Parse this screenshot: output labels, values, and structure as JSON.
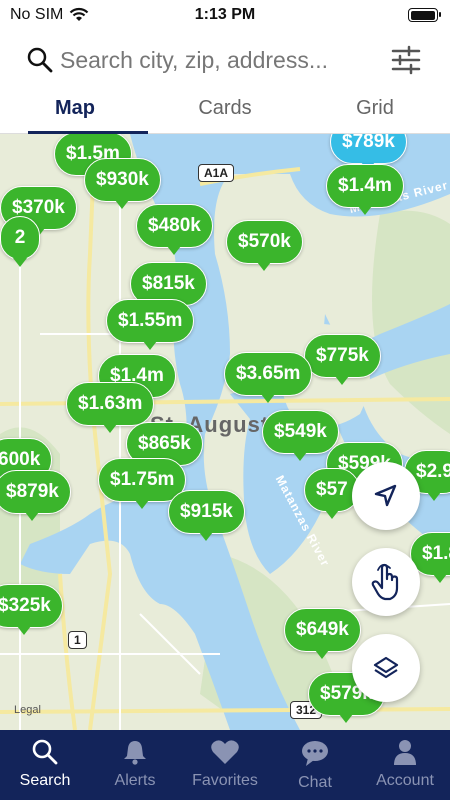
{
  "status_bar": {
    "carrier": "No SIM",
    "time": "1:13 PM"
  },
  "search": {
    "placeholder": "Search city, zip, address..."
  },
  "tabs": [
    {
      "label": "Map",
      "active": true
    },
    {
      "label": "Cards",
      "active": false
    },
    {
      "label": "Grid",
      "active": false
    }
  ],
  "map": {
    "water_labels": [
      "Matanzas River",
      "Matanzas River"
    ],
    "place_label": "St. Augustine",
    "road_shields": [
      "A1A",
      "1",
      "312"
    ],
    "legal": "Legal"
  },
  "price_pins": [
    {
      "label": "$1.5m",
      "color": "green"
    },
    {
      "label": "$930k",
      "color": "green"
    },
    {
      "label": "$370k",
      "color": "green"
    },
    {
      "label": "2",
      "color": "green"
    },
    {
      "label": "$480k",
      "color": "green"
    },
    {
      "label": "$570k",
      "color": "green"
    },
    {
      "label": "$789k",
      "color": "blue"
    },
    {
      "label": "$1.4m",
      "color": "green"
    },
    {
      "label": "$815k",
      "color": "green"
    },
    {
      "label": "$1.55m",
      "color": "green"
    },
    {
      "label": "$775k",
      "color": "green"
    },
    {
      "label": "$1.4m",
      "color": "green"
    },
    {
      "label": "$3.65m",
      "color": "green"
    },
    {
      "label": "$1.63m",
      "color": "green"
    },
    {
      "label": "$549k",
      "color": "green"
    },
    {
      "label": "$865k",
      "color": "green"
    },
    {
      "label": "600k",
      "color": "green"
    },
    {
      "label": "$879k",
      "color": "green"
    },
    {
      "label": "$1.75m",
      "color": "green"
    },
    {
      "label": "$599k",
      "color": "green"
    },
    {
      "label": "$57",
      "color": "green"
    },
    {
      "label": "$2.9",
      "color": "green"
    },
    {
      "label": "$915k",
      "color": "green"
    },
    {
      "label": "$1.8",
      "color": "green"
    },
    {
      "label": "$325k",
      "color": "green"
    },
    {
      "label": "$649k",
      "color": "green"
    },
    {
      "label": "$579k",
      "color": "green"
    }
  ],
  "map_controls": [
    {
      "name": "location",
      "icon": "location-arrow-icon"
    },
    {
      "name": "draw",
      "icon": "hand-draw-icon"
    },
    {
      "name": "layers",
      "icon": "layers-icon"
    }
  ],
  "nav": [
    {
      "label": "Search",
      "icon": "search-icon",
      "active": true
    },
    {
      "label": "Alerts",
      "icon": "bell-icon",
      "active": false
    },
    {
      "label": "Favorites",
      "icon": "heart-icon",
      "active": false
    },
    {
      "label": "Chat",
      "icon": "chat-icon",
      "active": false
    },
    {
      "label": "Account",
      "icon": "account-icon",
      "active": false
    }
  ],
  "colors": {
    "pin_green": "#3bb52c",
    "pin_blue": "#35bde6",
    "nav_bg": "#13245a",
    "water": "#a9d4f2",
    "land": "#e8ecd9"
  }
}
